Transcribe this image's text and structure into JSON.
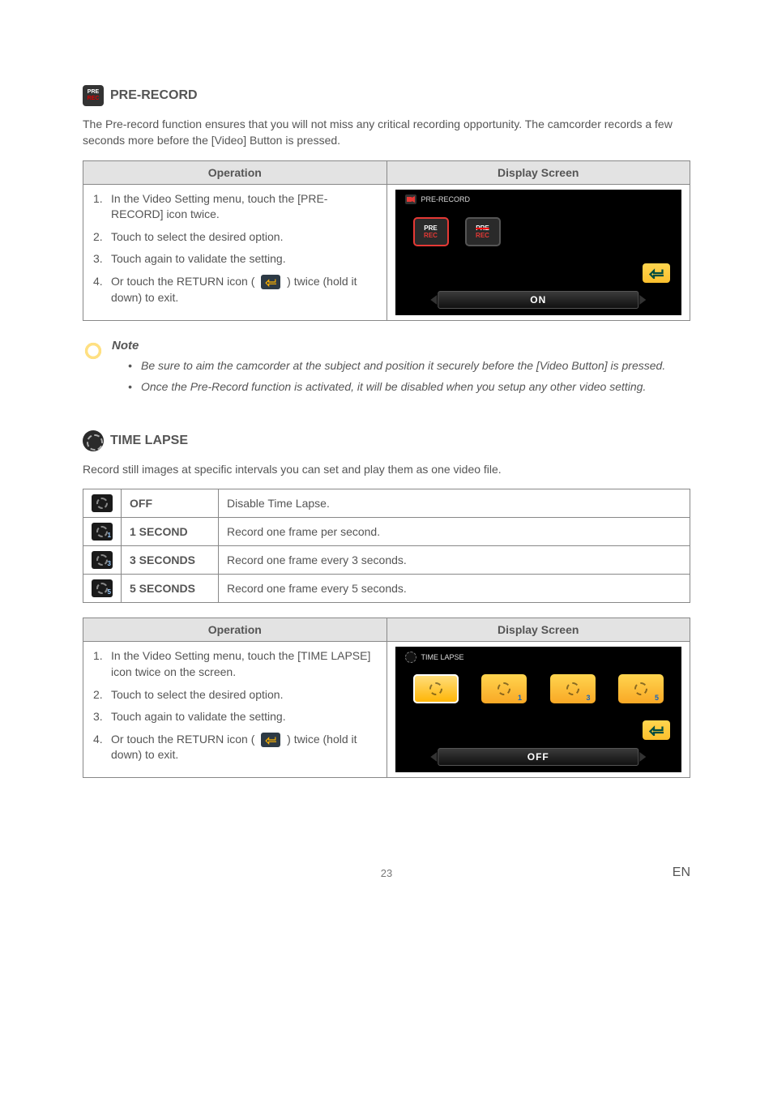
{
  "prerecord": {
    "heading": "PRE-RECORD",
    "intro": "The Pre-record function ensures that you will not miss any critical recording opportunity. The camcorder records a few seconds more before the [Video] Button is pressed.",
    "table": {
      "col1": "Operation",
      "col2": "Display Screen",
      "steps": [
        {
          "num": "1.",
          "text": "In the Video Setting menu, touch the [PRE-RECORD] icon twice."
        },
        {
          "num": "2.",
          "text": "Touch to select the desired option."
        },
        {
          "num": "3.",
          "text": "Touch again to validate the setting."
        },
        {
          "num": "4.",
          "text_pre": "Or touch the RETURN icon (",
          "text_post": ") twice (hold it down) to exit."
        }
      ],
      "screen": {
        "header": "PRE-RECORD",
        "bottom": "ON"
      }
    }
  },
  "note": {
    "title": "Note",
    "items": [
      "Be sure to aim the camcorder at the subject and position it securely before the [Video Button] is pressed.",
      "Once the Pre-Record function is activated, it will be disabled when you setup any other video setting."
    ]
  },
  "timelapse": {
    "heading": "TIME LAPSE",
    "intro": "Record still images at specific intervals you can set and play them as one video file.",
    "options": [
      {
        "name": "OFF",
        "desc": "Disable Time Lapse.",
        "cls": "tl-off"
      },
      {
        "name": "1 SECOND",
        "desc": "Record one frame per second.",
        "cls": "tl-1"
      },
      {
        "name": "3 SECONDS",
        "desc": "Record one frame every 3 seconds.",
        "cls": "tl-3"
      },
      {
        "name": "5 SECONDS",
        "desc": "Record one frame every 5 seconds.",
        "cls": "tl-5"
      }
    ],
    "table": {
      "col1": "Operation",
      "col2": "Display Screen",
      "steps": [
        {
          "num": "1.",
          "text": "In the Video Setting menu, touch the [TIME LAPSE] icon twice on the screen."
        },
        {
          "num": "2.",
          "text": "Touch to select the desired option."
        },
        {
          "num": "3.",
          "text": "Touch again to validate the setting."
        },
        {
          "num": "4.",
          "text_pre": "Or touch the RETURN icon (",
          "text_post": ") twice (hold it down) to exit."
        }
      ],
      "screen": {
        "header": "TIME LAPSE",
        "bottom": "OFF"
      }
    }
  },
  "footer": {
    "page": "23",
    "lang": "EN"
  }
}
